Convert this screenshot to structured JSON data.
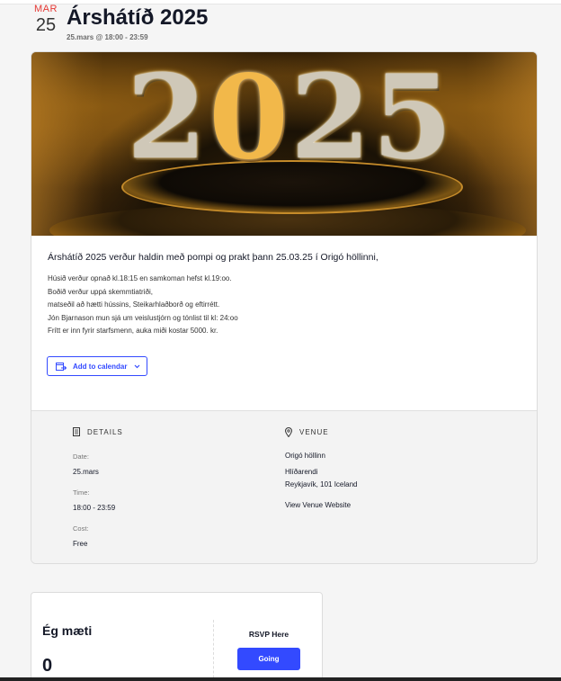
{
  "event": {
    "month": "MAR",
    "day": "25",
    "title": "Árshátíð 2025",
    "time": "25.mars @ 18:00 - 23:59"
  },
  "hero": {
    "digits": [
      "2",
      "0",
      "2",
      "5"
    ],
    "colors": {
      "gold": "#f2b84a",
      "silver": "#cfc8b8",
      "dark": "#1a1206"
    }
  },
  "description": {
    "intro": "Árshátíð 2025 verður haldin með pompi og prakt þann 25.03.25 í Origó höllinni,",
    "lines": [
      "Húsið verður opnað kl.18:15 en samkoman hefst kl.19:oo.",
      "Boðið verður uppá skemmtiatriði,",
      "matseðil að hætti hússins, Steikarhlaðborð og eftirrétt.",
      "Jón Bjarnason mun sjá um veislustjórn og tónlist til kl: 24:oo",
      "Frítt er inn fyrir starfsmenn, auka miði kostar 5000. kr."
    ]
  },
  "calendar_button": {
    "label": "Add to calendar",
    "icon": "calendar-export-icon"
  },
  "details": {
    "heading": "DETAILS",
    "date_label": "Date:",
    "date_value": "25.mars",
    "time_label": "Time:",
    "time_value": "18:00 - 23:59",
    "cost_label": "Cost:",
    "cost_value": "Free"
  },
  "venue": {
    "heading": "VENUE",
    "name": "Origó höllinn",
    "street": "Hlíðarendi",
    "city": "Reykjavík, 101 Iceland",
    "website_label": "View Venue Website"
  },
  "rsvp": {
    "title": "Ég mæti",
    "count": "0",
    "prompt": "RSVP Here",
    "going_label": "Going"
  },
  "colors": {
    "accent": "#334aff",
    "month": "#e53935",
    "text": "#141827"
  }
}
